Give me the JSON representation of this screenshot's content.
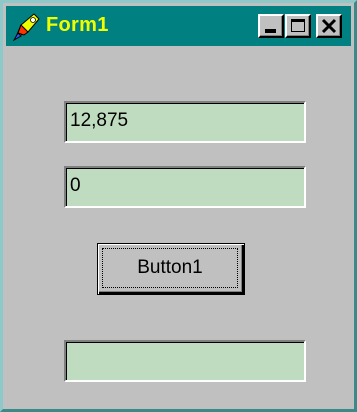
{
  "window": {
    "title": "Form1",
    "title_color": "#f0ff00",
    "titlebar_color": "#008080",
    "icon": "app-icon"
  },
  "caption_buttons": {
    "minimize_icon": "minimize-icon",
    "maximize_icon": "maximize-icon",
    "close_icon": "close-icon"
  },
  "fields": {
    "text1_value": "12,875",
    "text2_value": "0",
    "text3_value": ""
  },
  "button1": {
    "label": "Button1"
  },
  "colors": {
    "field_background": "#c0dcc0",
    "form_background": "#c0c0c0"
  }
}
